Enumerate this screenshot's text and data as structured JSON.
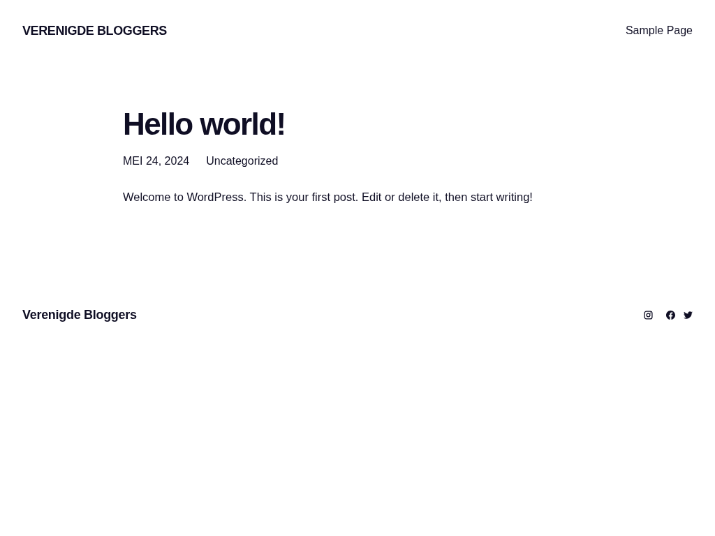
{
  "header": {
    "site_title": "VERENIGDE BLOGGERS",
    "nav": [
      {
        "label": "Sample Page"
      }
    ]
  },
  "post": {
    "title": "Hello world!",
    "date": "MEI 24, 2024",
    "category": "Uncategorized",
    "body": "Welcome to WordPress. This is your first post. Edit or delete it, then start writing!"
  },
  "footer": {
    "site_title": "Verenigde Bloggers"
  }
}
